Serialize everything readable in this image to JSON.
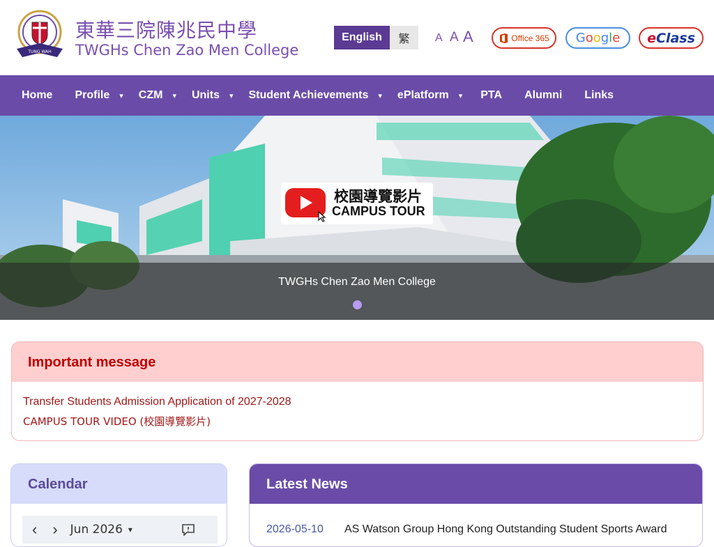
{
  "header": {
    "school_name_cn": "東華三院陳兆民中學",
    "school_name_en": "TWGHs Chen Zao Men College",
    "lang_english": "English",
    "lang_chinese": "繁",
    "font_sizes": [
      "A",
      "A",
      "A"
    ],
    "office_label": "Office 365",
    "google_label": [
      "G",
      "o",
      "o",
      "g",
      "l",
      "e"
    ],
    "eclass_label": [
      "e",
      "Class"
    ]
  },
  "nav": {
    "items": [
      {
        "label": "Home",
        "has_dropdown": false
      },
      {
        "label": "Profile",
        "has_dropdown": true
      },
      {
        "label": "CZM",
        "has_dropdown": true
      },
      {
        "label": "Units",
        "has_dropdown": true
      },
      {
        "label": "Student Achievements",
        "has_dropdown": true
      },
      {
        "label": "ePlatform",
        "has_dropdown": true
      },
      {
        "label": "PTA",
        "has_dropdown": false
      },
      {
        "label": "Alumni",
        "has_dropdown": false
      },
      {
        "label": "Links",
        "has_dropdown": false
      }
    ],
    "caret": "▾"
  },
  "hero": {
    "caption": "TWGHs Chen Zao Men College",
    "tour_cn": "校園導覽影片",
    "tour_en": "CAMPUS TOUR"
  },
  "important": {
    "title": "Important message",
    "links": [
      "Transfer Students Admission Application of 2027-2028",
      "CAMPUS TOUR VIDEO (校園導覽影片)"
    ]
  },
  "calendar": {
    "title": "Calendar",
    "month": "Jun 2026",
    "prev": "‹",
    "next": "›",
    "month_caret": "▾"
  },
  "news": {
    "title": "Latest News",
    "items": [
      {
        "date": "2026-05-10",
        "title": "AS Watson Group Hong Kong Outstanding Student Sports Award"
      }
    ]
  },
  "colors": {
    "nav_bg": "#6a4ca8",
    "brand_purple": "#7a4fb0",
    "important_bg": "#ffcfcf",
    "important_text": "#c00000",
    "calendar_bg": "#d7dcfb"
  }
}
